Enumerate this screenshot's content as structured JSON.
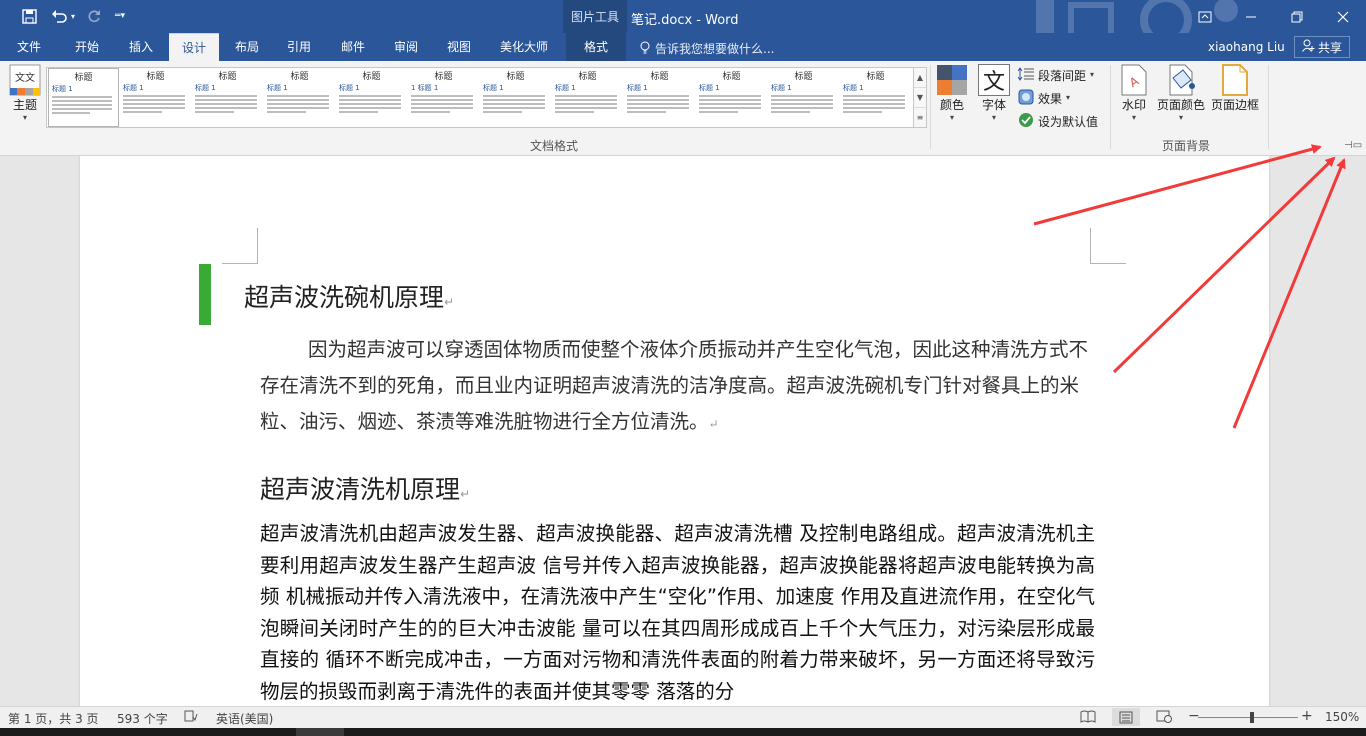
{
  "titlebar": {
    "picture_tools": "图片工具",
    "document_title": "笔记.docx - Word",
    "qat_icons": [
      "save-icon",
      "undo-icon",
      "redo-icon",
      "customize-icon"
    ],
    "window_icons": [
      "ribbon-display-icon",
      "minimize-icon",
      "restore-icon",
      "close-icon"
    ]
  },
  "tabs": [
    {
      "label": "文件"
    },
    {
      "label": "开始"
    },
    {
      "label": "插入"
    },
    {
      "label": "设计",
      "active": true
    },
    {
      "label": "布局"
    },
    {
      "label": "引用"
    },
    {
      "label": "邮件"
    },
    {
      "label": "审阅"
    },
    {
      "label": "视图"
    },
    {
      "label": "美化大师"
    },
    {
      "label": "格式"
    }
  ],
  "tellme": "告诉我您想要做什么...",
  "user": {
    "name": "xiaohang Liu",
    "share_label": "共享"
  },
  "ribbon": {
    "theme_label": "主题",
    "theme_icon_text": "文文",
    "gallery": [
      {
        "title": "标题",
        "heading": "标题 1"
      },
      {
        "title": "标题",
        "heading": "标题 1"
      },
      {
        "title": "标题",
        "heading": "标题 1"
      },
      {
        "title": "标题",
        "heading": "标题 1"
      },
      {
        "title": "标题",
        "heading": "标题 1"
      },
      {
        "title": "标题",
        "heading": "1 标题 1"
      },
      {
        "title": "标题",
        "heading": "标题 1"
      },
      {
        "title": "标题",
        "heading": "标题 1"
      },
      {
        "title": "标题",
        "heading": "标题 1"
      },
      {
        "title": "标题",
        "heading": "标题 1"
      },
      {
        "title": "标题",
        "heading": "标题 1"
      },
      {
        "title": "标题",
        "heading": "标题 1"
      }
    ],
    "doc_format_label": "文档格式",
    "colors_label": "颜色",
    "fonts_label": "字体",
    "fonts_icon_text": "文",
    "paragraph_spacing_label": "段落间距",
    "effects_label": "效果",
    "set_default_label": "设为默认值",
    "watermark_label": "水印",
    "page_color_label": "页面颜色",
    "page_borders_label": "页面边框",
    "page_background_label": "页面背景"
  },
  "document": {
    "heading1": "超声波洗碗机原理",
    "para1": "因为超声波可以穿透固体物质而使整个液体介质振动并产生空化气泡，因此这种清洗方式不存在清洗不到的死角，而且业内证明超声波清洗的洁净度高。超声波洗碗机专门针对餐具上的米粒、油污、烟迹、茶渍等难洗脏物进行全方位清洗。",
    "heading2": "超声波清洗机原理",
    "para2": "超声波清洗机由超声波发生器、超声波换能器、超声波清洗槽  及控制电路组成。超声波清洗机主要利用超声波发生器产生超声波  信号并传入超声波换能器，超声波换能器将超声波电能转换为高频  机械振动并传入清洗液中，在清洗液中产生“空化”作用、加速度  作用及直进流作用，在空化气泡瞬间关闭时产生的的巨大冲击波能  量可以在其四周形成成百上千个大气压力，对污染层形成最直接的  循环不断完成冲击，一方面对污物和清洗件表面的附着力带来破坏，另一方面还将导致污物层的损毁而剥离于清洗件的表面并使其零零  落落的分",
    "paragraph_mark": "↵",
    "accent_bar_color": "#3aaa35"
  },
  "status": {
    "page": "第 1 页，共 3 页",
    "words": "593 个字",
    "language": "英语(美国)",
    "zoom": "150%",
    "zoom_minus": "−",
    "zoom_plus": "+"
  },
  "colors": {
    "brand": "#2b579a",
    "annotation_arrow": "#f23a3a"
  }
}
